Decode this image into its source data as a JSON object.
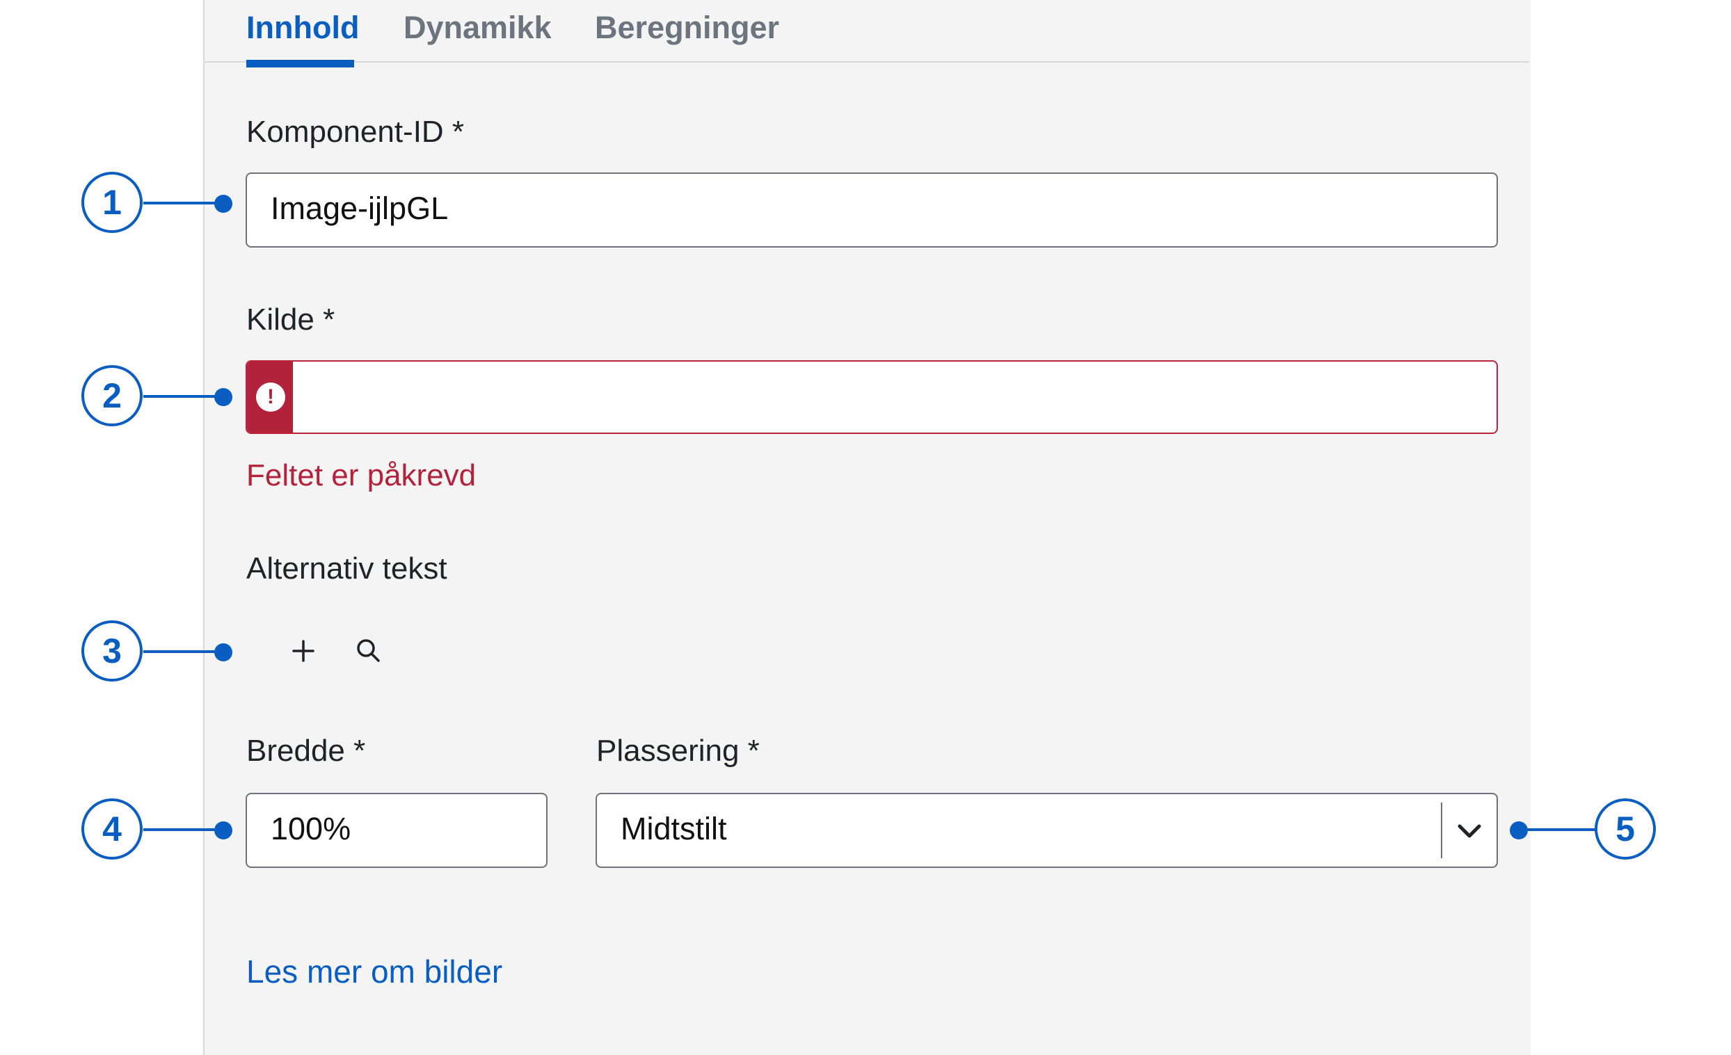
{
  "tabs": [
    {
      "label": "Innhold",
      "active": true
    },
    {
      "label": "Dynamikk",
      "active": false
    },
    {
      "label": "Beregninger",
      "active": false
    }
  ],
  "fields": {
    "component_id": {
      "label": "Komponent-ID *",
      "value": "Image-ijlpGL"
    },
    "source": {
      "label": "Kilde *",
      "value": "",
      "error": "Feltet er påkrevd",
      "error_icon": "!"
    },
    "alt_text": {
      "label": "Alternativ tekst",
      "icons": [
        "plus-icon",
        "search-icon"
      ]
    },
    "width": {
      "label": "Bredde *",
      "value": "100%"
    },
    "placement": {
      "label": "Plassering *",
      "value": "Midtstilt"
    }
  },
  "link": {
    "label": "Les mer om bilder"
  },
  "callouts": [
    "1",
    "2",
    "3",
    "4",
    "5"
  ],
  "colors": {
    "accent": "#0a5ec1",
    "error": "#b3223b",
    "panel_bg": "#f4f4f4"
  }
}
